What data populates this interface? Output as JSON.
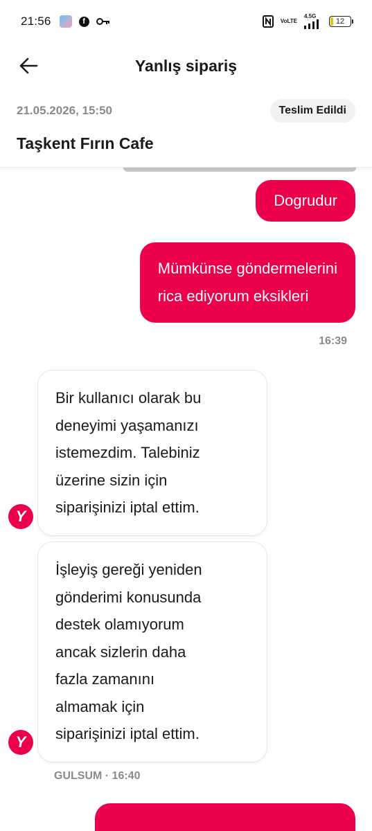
{
  "status_bar": {
    "time": "21:56",
    "left_icons": [
      "app-avatar-icon",
      "facebook-icon",
      "key-icon"
    ],
    "right_icons": [
      "nfc-icon",
      "volte-icon",
      "signal-icon",
      "battery-icon"
    ],
    "volte_top": "Vo",
    "volte_bottom": "LTE",
    "network": "4.5G",
    "battery_level": "12"
  },
  "header": {
    "title": "Yanlış sipariş",
    "back_icon": "arrow-left-icon"
  },
  "order": {
    "date": "21.05.2026, 15:50",
    "status": "Teslim Edildi",
    "restaurant": "Taşkent Fırın Cafe"
  },
  "messages": {
    "out_1": {
      "text": "Dogrudur"
    },
    "out_2": {
      "line1": "Mümkünse göndermelerini",
      "line2": "rica ediyorum eksikleri"
    },
    "out_time": "16:39",
    "in_1": {
      "lines": [
        "Bir kullanıcı olarak bu",
        "deneyimi yaşamanızı",
        "istemezdim. Talebiniz",
        "üzerine sizin için",
        "siparişinizi iptal ettim."
      ]
    },
    "in_2": {
      "lines": [
        "İşleyiş gereği yeniden",
        "gönderimi konusunda",
        "destek olamıyorum",
        "ancak sizlerin daha",
        "fazla zamanını",
        "almamak için",
        "siparişinizi iptal ettim."
      ]
    },
    "in_sender": "GULSUM · 16:40",
    "agent_logo_letter": "Y"
  },
  "colors": {
    "brand": "#ea004b",
    "badge_bg": "#f1f1f1",
    "muted_text": "#8a8a8a"
  }
}
